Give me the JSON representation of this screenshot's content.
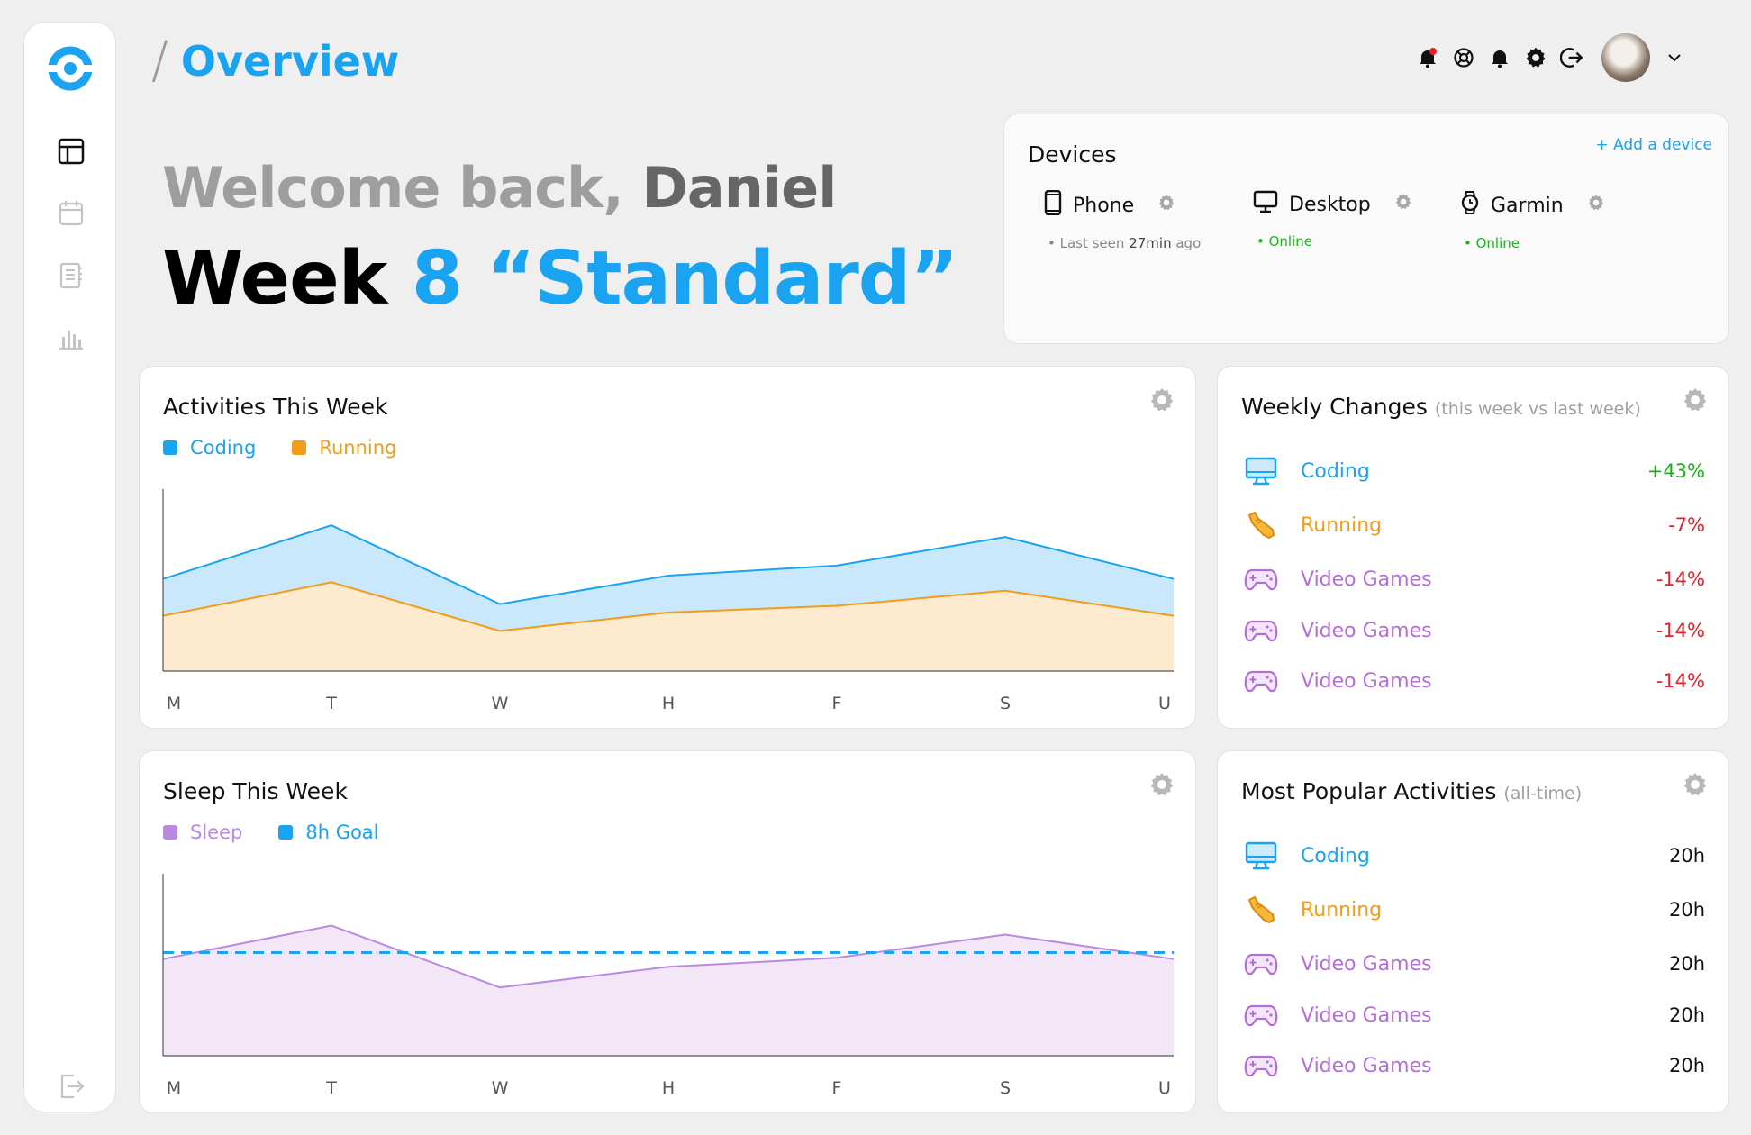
{
  "header": {
    "title": "Overview"
  },
  "hero": {
    "welcome_prefix": "Welcome back,",
    "user_name": "Daniel",
    "week_prefix": "Week",
    "week_name": "8 “Standard”"
  },
  "devices": {
    "title": "Devices",
    "add_label": "+ Add a device",
    "items": [
      {
        "name": "Phone",
        "status_prefix": "• Last seen",
        "status_value": "27min",
        "status_suffix": "ago",
        "icon": "phone-icon"
      },
      {
        "name": "Desktop",
        "status": "• Online",
        "icon": "desktop-icon"
      },
      {
        "name": "Garmin",
        "status": "• Online",
        "icon": "watch-icon"
      }
    ]
  },
  "activities": {
    "title": "Activities This Week",
    "legend": [
      {
        "label": "Coding",
        "color": "#1aa3f1"
      },
      {
        "label": "Running",
        "color": "#f19c1a"
      }
    ]
  },
  "sleep": {
    "title": "Sleep This Week",
    "legend": [
      {
        "label": "Sleep",
        "color": "#b98ae0"
      },
      {
        "label": "8h Goal",
        "color": "#1aa3f1"
      }
    ]
  },
  "weekly_changes": {
    "title": "Weekly Changes",
    "subtitle": "(this week vs last week)",
    "items": [
      {
        "label": "Coding",
        "value": "+43%",
        "icon": "monitor-icon"
      },
      {
        "label": "Running",
        "value": "-7%",
        "icon": "running-shoe-icon"
      },
      {
        "label": "Video Games",
        "value": "-14%",
        "icon": "gamepad-icon"
      },
      {
        "label": "Video Games",
        "value": "-14%",
        "icon": "gamepad-icon"
      },
      {
        "label": "Video Games",
        "value": "-14%",
        "icon": "gamepad-icon"
      }
    ]
  },
  "popular": {
    "title": "Most Popular Activities",
    "subtitle": "(all-time)",
    "items": [
      {
        "label": "Coding",
        "value": "20h",
        "icon": "monitor-icon"
      },
      {
        "label": "Running",
        "value": "20h",
        "icon": "running-shoe-icon"
      },
      {
        "label": "Video Games",
        "value": "20h",
        "icon": "gamepad-icon"
      },
      {
        "label": "Video Games",
        "value": "20h",
        "icon": "gamepad-icon"
      },
      {
        "label": "Video Games",
        "value": "20h",
        "icon": "gamepad-icon"
      }
    ]
  },
  "chart_data": [
    {
      "type": "area",
      "title": "Activities This Week",
      "categories": [
        "M",
        "T",
        "W",
        "H",
        "F",
        "S",
        "U"
      ],
      "series": [
        {
          "name": "Coding",
          "values": [
            55,
            87,
            40,
            57,
            63,
            80,
            55
          ]
        },
        {
          "name": "Running",
          "values": [
            33,
            53,
            24,
            35,
            39,
            48,
            33
          ]
        }
      ],
      "ylim": [
        0,
        100
      ],
      "grid": false,
      "legend": "top-left"
    },
    {
      "type": "area",
      "title": "Sleep This Week",
      "categories": [
        "M",
        "T",
        "W",
        "H",
        "F",
        "S",
        "U"
      ],
      "series": [
        {
          "name": "Sleep",
          "values": [
            7.5,
            10.1,
            5.3,
            6.9,
            7.6,
            9.4,
            7.5
          ]
        },
        {
          "name": "8h Goal",
          "values": [
            8,
            8,
            8,
            8,
            8,
            8,
            8
          ]
        }
      ],
      "ylim": [
        0,
        13
      ],
      "grid": false,
      "legend": "top-left"
    }
  ]
}
